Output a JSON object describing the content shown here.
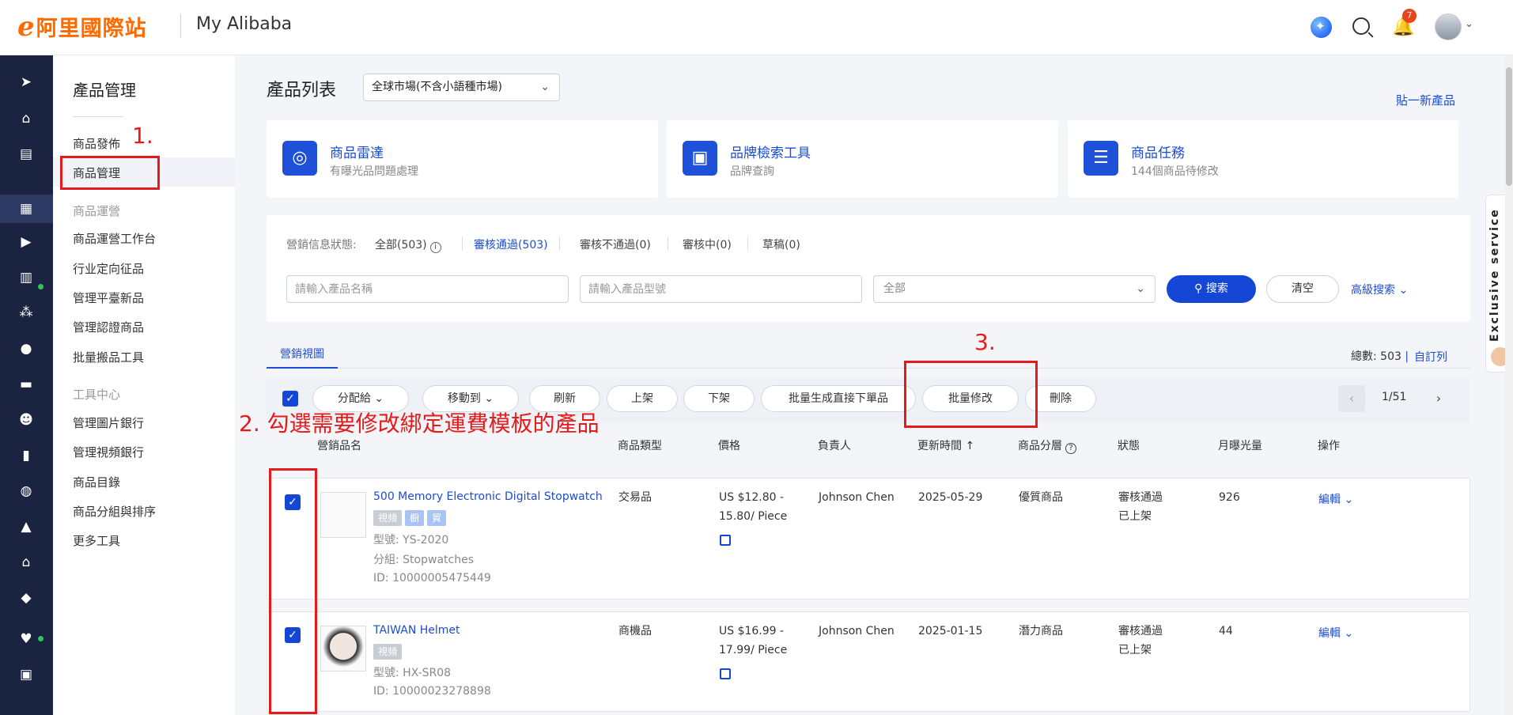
{
  "header": {
    "logo_mark": "e",
    "logo_text": "阿里國際站",
    "app_title": "My Alibaba",
    "notification_count": "7"
  },
  "subside": {
    "title": "產品管理",
    "items_top": [
      "商品發佈",
      "商品管理"
    ],
    "group1": "商品運營",
    "group1_items": [
      "商品運營工作台",
      "行业定向征品",
      "管理平臺新品",
      "管理認證商品",
      "批量搬品工具"
    ],
    "group2": "工具中心",
    "group2_items": [
      "管理圖片銀行",
      "管理視頻銀行",
      "商品目錄",
      "商品分組與排序",
      "更多工具"
    ]
  },
  "main": {
    "title": "產品列表",
    "market_select": "全球市場(不含小語種市場)",
    "post_new": "貼一新產品",
    "tools": [
      {
        "name": "商品雷達",
        "sub": "有曝光品問題處理",
        "icon": "radar-icon"
      },
      {
        "name": "品牌檢索工具",
        "sub": "品牌查詢",
        "icon": "briefcase-icon"
      },
      {
        "name": "商品任務",
        "sub": "144個商品待修改",
        "icon": "task-list-icon"
      }
    ],
    "status_label": "營銷信息狀態:",
    "statuses": [
      "全部(503)",
      "審核通過(503)",
      "審核不通過(0)",
      "審核中(0)",
      "草稿(0)"
    ],
    "name_placeholder": "請輸入產品名稱",
    "model_placeholder": "請輸入產品型號",
    "select_value": "全部",
    "search_btn": "搜索",
    "clear_btn": "清空",
    "advanced_search": "高級搜索",
    "view_tab": "營銷視圖",
    "total": "總數: 503",
    "custom_columns": "自訂列",
    "actions": [
      "分配給",
      "移動到",
      "刷新",
      "上架",
      "下架",
      "批量生成直接下單品",
      "批量修改",
      "刪除"
    ],
    "pager": "1/51",
    "columns": [
      "營銷品名",
      "商品類型",
      "價格",
      "負責人",
      "更新時間",
      "商品分層",
      "狀態",
      "月曝光量",
      "操作"
    ],
    "rows": [
      {
        "name": "500 Memory Electronic Digital Stopwatch",
        "tags": [
          "視頻",
          "橱",
          "貿"
        ],
        "model": "型號: YS-2020",
        "group": "分組: Stopwatches",
        "id": "ID: 10000005475449",
        "type": "交易品",
        "price1": "US $12.80 -",
        "price2": "15.80/ Piece",
        "owner": "Johnson Chen",
        "updated": "2025-05-29",
        "tier": "優質商品",
        "status1": "審核通過",
        "status2": "已上架",
        "views": "926",
        "edit": "編輯"
      },
      {
        "name": "TAIWAN Helmet",
        "tags": [
          "視頻"
        ],
        "model": "型號: HX-SR08",
        "id": "ID: 10000023278898",
        "type": "商機品",
        "price1": "US $16.99 -",
        "price2": "17.99/ Piece",
        "owner": "Johnson Chen",
        "updated": "2025-01-15",
        "tier": "潛力商品",
        "status1": "審核通過",
        "status2": "已上架",
        "views": "44",
        "edit": "編輯"
      }
    ]
  },
  "annotations": {
    "step1": "1.",
    "step2": "2. 勾選需要修改綁定運費模板的產品",
    "step3": "3."
  },
  "exclusive_service": "Exclusive service",
  "colors": {
    "brand": "#ff6a00",
    "primary": "#1547d6",
    "annotation": "#e31b1b",
    "rail": "#1a2340"
  }
}
